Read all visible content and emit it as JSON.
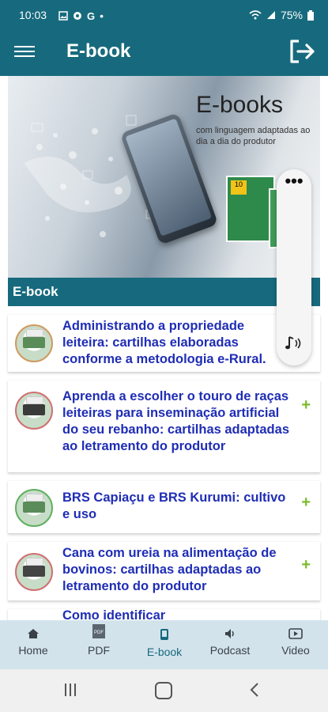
{
  "status": {
    "time": "10:03",
    "left_icons": [
      "gallery-icon",
      "chrome-icon",
      "google-icon",
      "dot-icon"
    ],
    "battery": "75%"
  },
  "appbar": {
    "title": "E-book"
  },
  "banner": {
    "title": "E-books",
    "subtitle": "com linguagem adaptadas ao dia a dia do produtor",
    "book_badge": "10"
  },
  "section": {
    "title": "E-book"
  },
  "items": [
    {
      "title": "Administrando a propriedade leiteira: cartilhas elaboradas conforme a metodologia e-Rural.",
      "expand": ""
    },
    {
      "title": "Aprenda a escolher o touro de raças leiteiras para inseminação artificial do seu rebanho: cartilhas adaptadas ao letramento do produtor",
      "expand": "+"
    },
    {
      "title": "BRS Capiaçu e BRS Kurumi: cultivo e uso",
      "expand": "+"
    },
    {
      "title": "Cana com ureia na alimentação de bovinos: cartilhas adaptadas ao letramento do produtor",
      "expand": "+"
    },
    {
      "title": "Como identificar",
      "expand": ""
    }
  ],
  "float_panel": {
    "menu": "•••"
  },
  "bottom_nav": {
    "home": "Home",
    "pdf": "PDF",
    "ebook": "E-book",
    "podcast": "Podcast",
    "video": "Video"
  },
  "colors": {
    "primary": "#176a7d",
    "link": "#1f2db5",
    "accent": "#7bbb2a",
    "nav_bg": "#d3e3ec"
  }
}
